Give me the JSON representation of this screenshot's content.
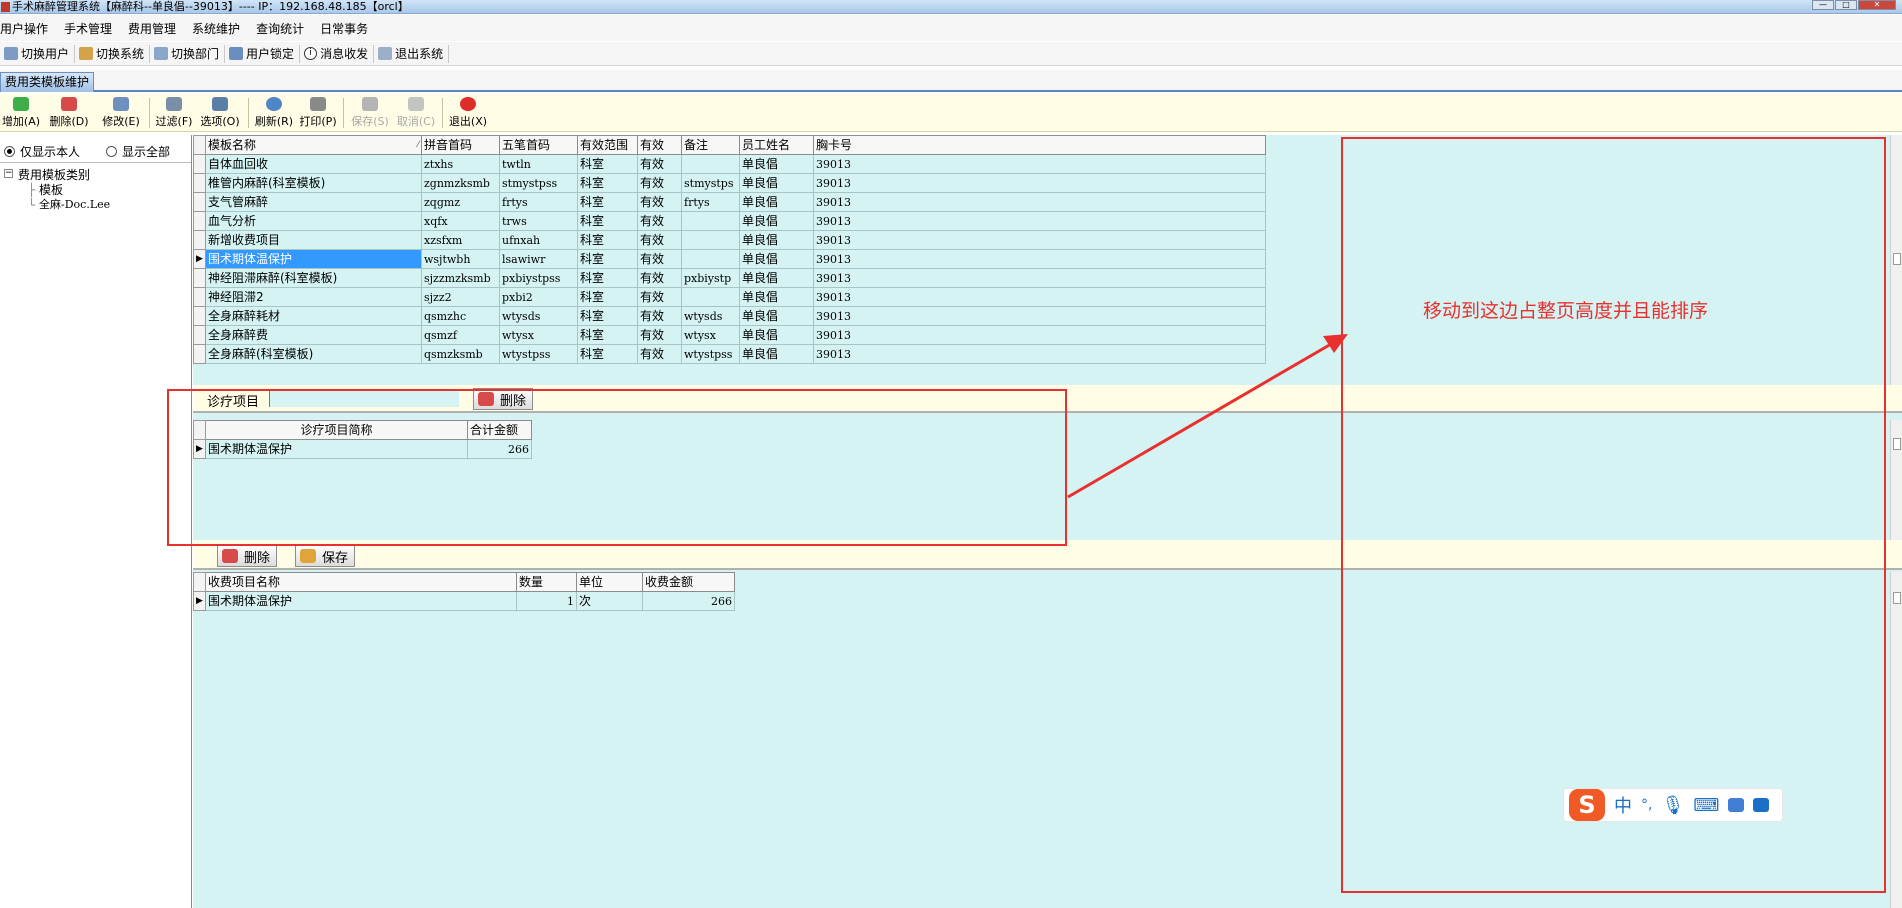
{
  "window": {
    "title": "手术麻醉管理系统【麻醉科--单良倡--39013】---- IP：192.168.48.185【orcl】"
  },
  "menubar": [
    "用户操作",
    "手术管理",
    "费用管理",
    "系统维护",
    "查询统计",
    "日常事务"
  ],
  "system_toolbar": [
    {
      "label": "切换用户",
      "icon": "switch-user-icon"
    },
    {
      "label": "切换系统",
      "icon": "switch-system-icon"
    },
    {
      "label": "切换部门",
      "icon": "switch-department-icon"
    },
    {
      "label": "用户锁定",
      "icon": "user-lock-icon"
    },
    {
      "label": "消息收发",
      "icon": "info-icon"
    },
    {
      "label": "退出系统",
      "icon": "exit-icon"
    }
  ],
  "tab": {
    "label": "费用类模板维护"
  },
  "toolbar": [
    {
      "label": "增加(A)",
      "icon": "add-icon",
      "enabled": true
    },
    {
      "label": "删除(D)",
      "icon": "delete-icon",
      "enabled": true
    },
    {
      "label": "修改(E)",
      "icon": "edit-icon",
      "enabled": true
    },
    {
      "label": "过滤(F)",
      "icon": "filter-icon",
      "enabled": true
    },
    {
      "label": "选项(O)",
      "icon": "options-icon",
      "enabled": true
    },
    {
      "label": "刷新(R)",
      "icon": "refresh-icon",
      "enabled": true
    },
    {
      "label": "打印(P)",
      "icon": "print-icon",
      "enabled": true
    },
    {
      "label": "保存(S)",
      "icon": "save-icon",
      "enabled": false
    },
    {
      "label": "取消(C)",
      "icon": "cancel-icon",
      "enabled": false
    },
    {
      "label": "退出(X)",
      "icon": "power-icon",
      "enabled": true
    }
  ],
  "left_panel": {
    "radio_only_self": "仅显示本人",
    "radio_show_all": "显示全部",
    "radio_selected": "only_self",
    "tree": {
      "root": "费用模板类别",
      "children": [
        "模板",
        "全麻-Doc.Lee"
      ]
    }
  },
  "template_grid": {
    "columns": [
      "模板名称",
      "拼音首码",
      "五笔首码",
      "有效范围",
      "有效",
      "备注",
      "员工姓名",
      "胸卡号"
    ],
    "selected_index": 5,
    "rows": [
      [
        "自体血回收",
        "ztxhs",
        "twtln",
        "科室",
        "有效",
        "",
        "单良倡",
        "39013"
      ],
      [
        "椎管内麻醉(科室模板)",
        "zgnmzksmb",
        "stmystpss",
        "科室",
        "有效",
        "stmystps",
        "单良倡",
        "39013"
      ],
      [
        "支气管麻醉",
        "zqgmz",
        "frtys",
        "科室",
        "有效",
        "frtys",
        "单良倡",
        "39013"
      ],
      [
        "血气分析",
        "xqfx",
        "trws",
        "科室",
        "有效",
        "",
        "单良倡",
        "39013"
      ],
      [
        "新增收费项目",
        "xzsfxm",
        "ufnxah",
        "科室",
        "有效",
        "",
        "单良倡",
        "39013"
      ],
      [
        "围术期体温保护",
        "wsjtwbh",
        "lsawiwr",
        "科室",
        "有效",
        "",
        "单良倡",
        "39013"
      ],
      [
        "神经阻滞麻醉(科室模板)",
        "sjzzmzksmb",
        "pxbiystpss",
        "科室",
        "有效",
        "pxbiystp",
        "单良倡",
        "39013"
      ],
      [
        "神经阻滞2",
        "sjzz2",
        "pxbi2",
        "科室",
        "有效",
        "",
        "单良倡",
        "39013"
      ],
      [
        "全身麻醉耗材",
        "qsmzhc",
        "wtysds",
        "科室",
        "有效",
        "wtysds",
        "单良倡",
        "39013"
      ],
      [
        "全身麻醉费",
        "qsmzf",
        "wtysx",
        "科室",
        "有效",
        "wtysx",
        "单良倡",
        "39013"
      ],
      [
        "全身麻醉(科室模板)",
        "qsmzksmb",
        "wtystpss",
        "科室",
        "有效",
        "wtystpss",
        "单良倡",
        "39013"
      ]
    ]
  },
  "diagnosis_section": {
    "label": "诊疗项目",
    "input_value": "",
    "delete_button": "删除",
    "columns": [
      "诊疗项目简称",
      "合计金额"
    ],
    "rows": [
      [
        "围术期体温保护",
        "266"
      ]
    ]
  },
  "charge_section": {
    "delete_button": "删除",
    "save_button": "保存",
    "columns": [
      "收费项目名称",
      "数量",
      "单位",
      "收费金额"
    ],
    "rows": [
      [
        "围术期体温保护",
        "1",
        "次",
        "266"
      ]
    ]
  },
  "annotation": {
    "text": "移动到这边占整页高度并且能排序",
    "color": "#e8312f"
  },
  "ime_toolbar": {
    "logo": "S",
    "mode": "中",
    "punct": "°,",
    "icons": [
      "microphone-icon",
      "keyboard-icon",
      "shirt-icon",
      "apps-icon"
    ]
  }
}
